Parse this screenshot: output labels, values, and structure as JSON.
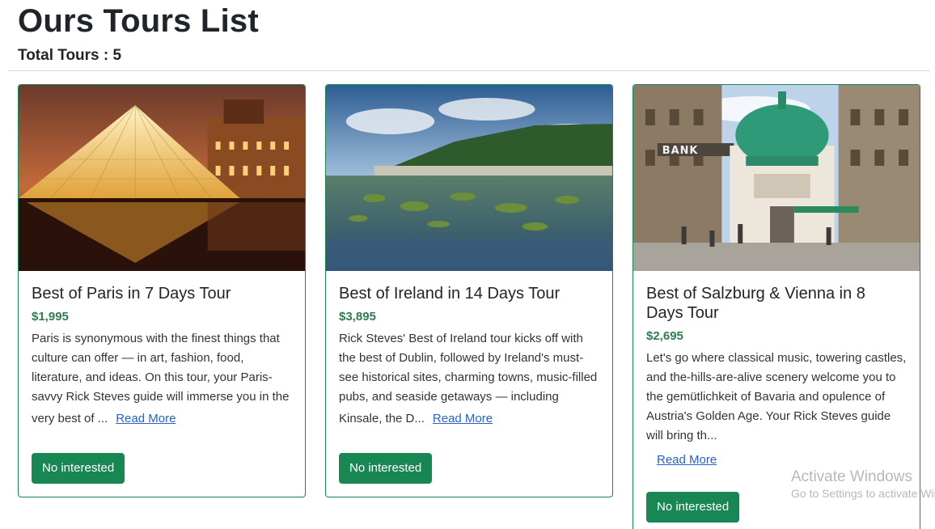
{
  "header": {
    "title": "Ours Tours List",
    "total_label": "Total Tours : 5"
  },
  "tours": [
    {
      "title": "Best of Paris in 7 Days Tour",
      "price": "$1,995",
      "description": "Paris is synonymous with the finest things that culture can offer — in art, fashion, food, literature, and ideas. On this tour, your Paris-savvy Rick Steves guide will immerse you in the very best of ...",
      "read_more": "Read More",
      "button": "No interested"
    },
    {
      "title": "Best of Ireland in 14 Days Tour",
      "price": "$3,895",
      "description": "Rick Steves' Best of Ireland tour kicks off with the best of Dublin, followed by Ireland's must-see historical sites, charming towns, music-filled pubs, and seaside getaways — including Kinsale, the D...",
      "read_more": "Read More",
      "button": "No interested"
    },
    {
      "title": "Best of Salzburg & Vienna in 8 Days Tour",
      "price": "$2,695",
      "description": "Let's go where classical music, towering castles, and the-hills-are-alive scenery welcome you to the gemütlichkeit of Bavaria and opulence of Austria's Golden Age. Your Rick Steves guide will bring th...",
      "read_more": "Read More",
      "button": "No interested",
      "sign_text": "BANK"
    }
  ],
  "watermark": {
    "title": "Activate Windows",
    "subtitle": "Go to Settings to activate Windows."
  }
}
